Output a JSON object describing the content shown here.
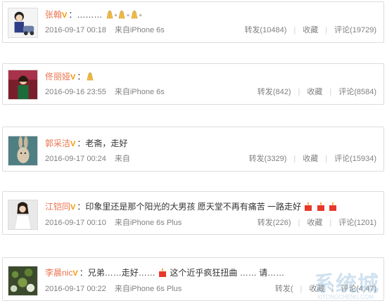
{
  "comments": [
    {
      "user": "张翰",
      "text": "………",
      "emojis": [
        "pray-emoji",
        "pray-emoji",
        "pray-emoji"
      ],
      "time": "2016-09-17 00:18",
      "source": "来自iPhone 6s",
      "repost": "转发(10484)",
      "fav": "收藏",
      "comment": "评论(19729)"
    },
    {
      "user": "佟丽娅",
      "text": "",
      "emojis": [
        "pray-emoji"
      ],
      "time": "2016-09-16 23:55",
      "source": "来自iPhone 6s",
      "repost": "转发(842)",
      "fav": "收藏",
      "comment": "评论(8584)"
    },
    {
      "user": "郭采洁",
      "text": "老斋，走好",
      "emojis": [],
      "time": "2016-09-17 00:24",
      "source": "来自",
      "repost": "转发(3329)",
      "fav": "收藏",
      "comment": "评论(15934)"
    },
    {
      "user": "江铠同",
      "text": "印象里还是那个阳光的大男孩 愿天堂不再有痛苦 一路走好",
      "emojis": [
        "candle-emoji",
        "candle-emoji",
        "candle-emoji"
      ],
      "time": "2016-09-17 00:10",
      "source": "来自iPhone 6s Plus",
      "repost": "转发(226)",
      "fav": "收藏",
      "comment": "评论(1201)"
    },
    {
      "user": "李晨nic",
      "text": "兄弟……走好……",
      "text2": "这个近乎疯狂扭曲 …… 请……",
      "emojis": [
        "candle-emoji"
      ],
      "time": "2016-09-17 00:22",
      "source": "来自iPhone 6s Plus",
      "repost": "转发(",
      "fav": "收藏",
      "comment": "评论(4.47)"
    }
  ],
  "watermark": "系统城",
  "watermark_sub": "XITONGCHENG.COM"
}
